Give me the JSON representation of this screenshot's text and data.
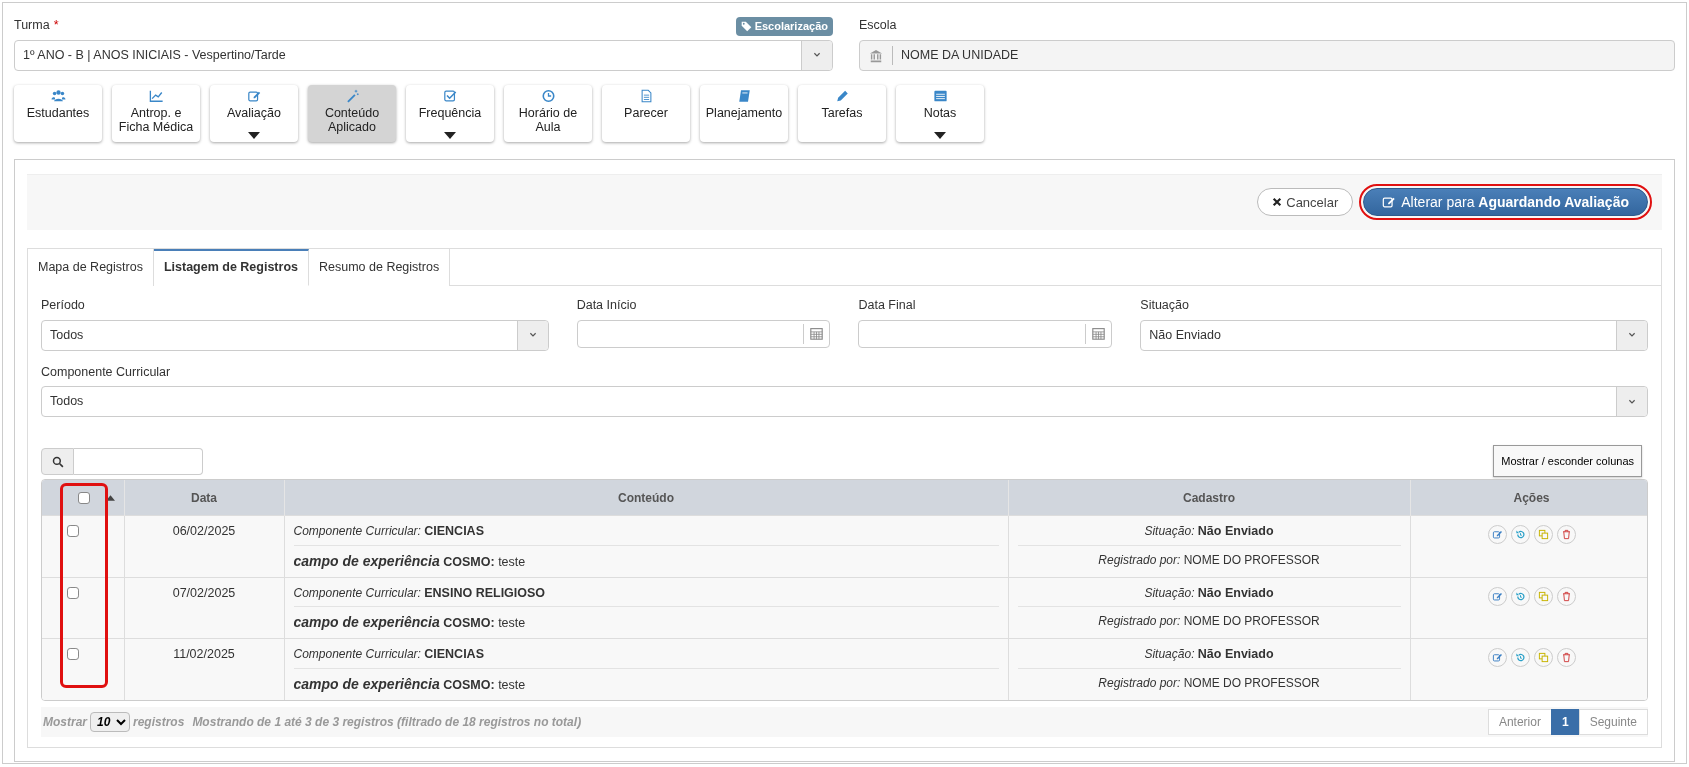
{
  "turma": {
    "label": "Turma",
    "required_mark": "*",
    "badge": "Escolarização",
    "value": "1º ANO - B | ANOS INICIAIS - Vespertino/Tarde"
  },
  "escola": {
    "label": "Escola",
    "value": "NOME DA UNIDADE"
  },
  "toolbar": [
    {
      "label": "Estudantes",
      "dropdown": false,
      "selected": false
    },
    {
      "label": "Antrop. e Ficha Médica",
      "dropdown": false,
      "selected": false
    },
    {
      "label": "Avaliação",
      "dropdown": true,
      "selected": false
    },
    {
      "label": "Conteúdo Aplicado",
      "dropdown": false,
      "selected": true
    },
    {
      "label": "Frequência",
      "dropdown": true,
      "selected": false
    },
    {
      "label": "Horário de Aula",
      "dropdown": false,
      "selected": false
    },
    {
      "label": "Parecer",
      "dropdown": false,
      "selected": false
    },
    {
      "label": "Planejamento",
      "dropdown": false,
      "selected": false
    },
    {
      "label": "Tarefas",
      "dropdown": false,
      "selected": false
    },
    {
      "label": "Notas",
      "dropdown": true,
      "selected": false
    }
  ],
  "actions": {
    "cancel": "Cancelar",
    "primary": "Alterar para **Aguardando Avaliação**",
    "primary_highlighted": true
  },
  "tabs": [
    {
      "label": "Mapa de Registros",
      "selected": false
    },
    {
      "label": "Listagem de Registros",
      "selected": true
    },
    {
      "label": "Resumo de Registros",
      "selected": false
    }
  ],
  "filter_rows": [
    [
      {
        "label": "Período",
        "kind": "select",
        "value": "Todos"
      },
      {
        "label": "Data Início",
        "kind": "date"
      },
      {
        "label": "Data Final",
        "kind": "date"
      },
      {
        "label": "Situação",
        "kind": "select",
        "value": "Não Enviado"
      }
    ],
    [
      {
        "label": "Componente Curricular",
        "kind": "select",
        "value": "Todos"
      }
    ]
  ],
  "table": {
    "column_toggle": "Mostrar / esconder colunas",
    "select_all_checked": false,
    "checkbox_column_highlighted": true,
    "columns": [
      "Data",
      "Conteúdo",
      "Cadastro",
      "Ações"
    ],
    "rows": [
      {
        "checked": false,
        "date": "06/02/2025",
        "content": [
          "*Componente Curricular:* **CIENCIAS**",
          "*campo de experiência* **COSMO:** teste"
        ],
        "cadastro": [
          "*Situação:* **Não Enviado**",
          "*Registrado por:* NOME DO PROFESSOR"
        ]
      },
      {
        "checked": false,
        "date": "07/02/2025",
        "content": [
          "*Componente Curricular:* **ENSINO RELIGIOSO**",
          "*campo de experiência* **COSMO:** teste"
        ],
        "cadastro": [
          "*Situação:* **Não Enviado**",
          "*Registrado por:* NOME DO PROFESSOR"
        ]
      },
      {
        "checked": false,
        "date": "11/02/2025",
        "content": [
          "*Componente Curricular:* **CIENCIAS**",
          "*campo de experiência* **COSMO:** teste"
        ],
        "cadastro": [
          "*Situação:* **Não Enviado**",
          "*Registrado por:* NOME DO PROFESSOR"
        ]
      }
    ]
  },
  "footer": {
    "show_label": "Mostrar",
    "page_size": "10",
    "records_label": "registros",
    "info": "Mostrando de 1 até 3 de 3 registros (filtrado de 18 registros no total)",
    "pages": [
      {
        "label": "Anterior",
        "selected": false
      },
      {
        "label": "1",
        "selected": true
      },
      {
        "label": "Seguinte",
        "selected": false
      }
    ]
  }
}
